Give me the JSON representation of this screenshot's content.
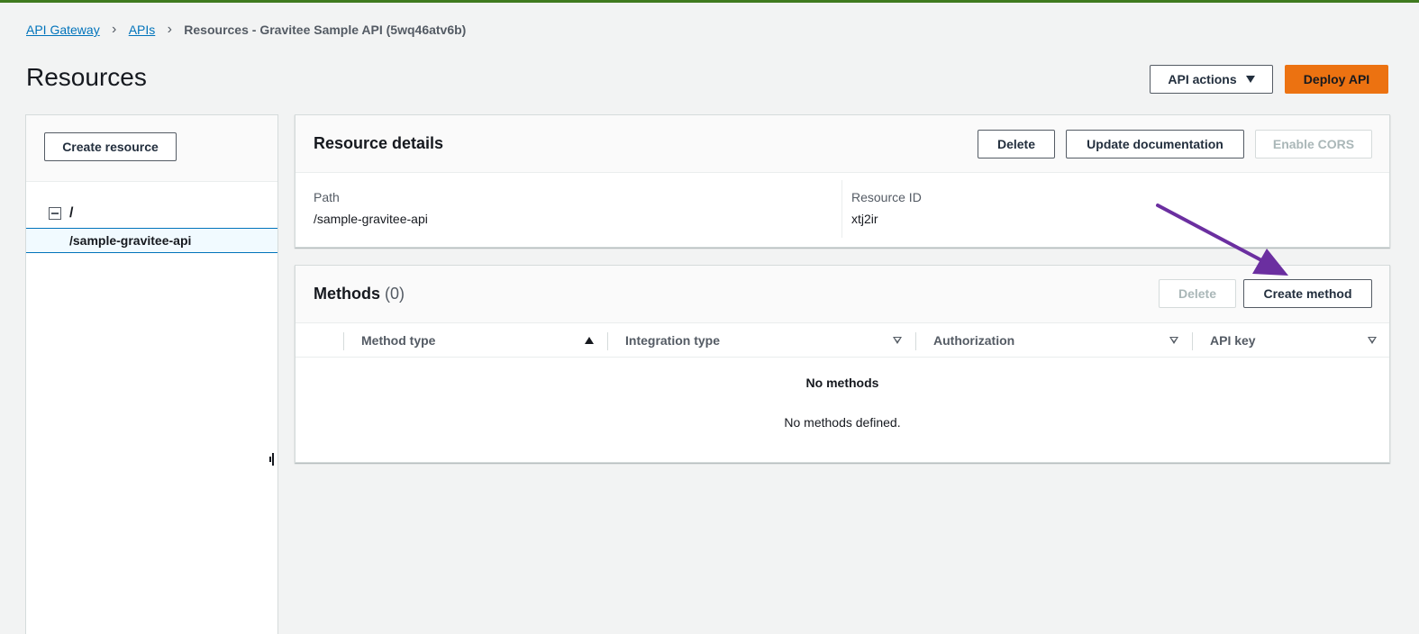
{
  "breadcrumb": {
    "items": [
      "API Gateway",
      "APIs"
    ],
    "current": "Resources - Gravitee Sample API (5wq46atv6b)",
    "separator": "›"
  },
  "page": {
    "title": "Resources"
  },
  "header_actions": {
    "api_actions": "API actions",
    "deploy": "Deploy API"
  },
  "left_panel": {
    "create_resource": "Create resource",
    "tree": {
      "root": "/",
      "child": "/sample-gravitee-api"
    }
  },
  "resource_details": {
    "title": "Resource details",
    "delete": "Delete",
    "update_documentation": "Update documentation",
    "enable_cors": "Enable CORS",
    "path_label": "Path",
    "path_value": "/sample-gravitee-api",
    "id_label": "Resource ID",
    "id_value": "xtj2ir"
  },
  "methods": {
    "title": "Methods",
    "count": "(0)",
    "delete": "Delete",
    "create": "Create method",
    "columns": [
      "Method type",
      "Integration type",
      "Authorization",
      "API key"
    ],
    "empty_title": "No methods",
    "empty_desc": "No methods defined."
  },
  "colors": {
    "accent_primary": "#ec7211",
    "link": "#0073bb",
    "annotation_arrow": "#6b2fa0",
    "top_strip": "#3f7a1f"
  },
  "icons": [
    "chevron-right-icon",
    "caret-down-icon",
    "collapse-minus-icon",
    "sort-asc-icon",
    "sort-desc-icon",
    "resize-handle-icon",
    "annotation-arrow"
  ]
}
